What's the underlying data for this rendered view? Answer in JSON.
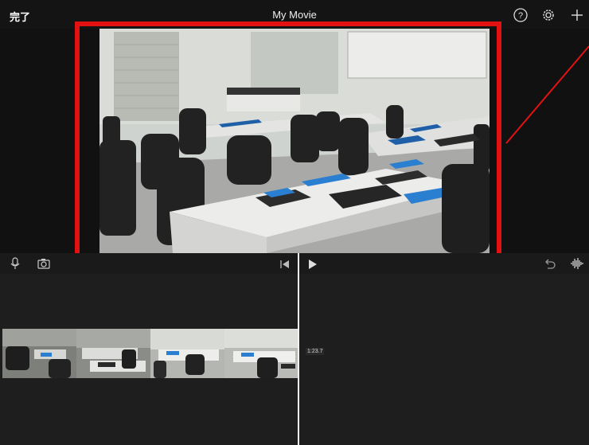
{
  "topbar": {
    "done_label": "完了",
    "title": "My Movie",
    "help_icon": "help-circle-icon",
    "settings_icon": "gear-icon",
    "add_icon": "plus-icon"
  },
  "controls": {
    "mic_icon": "microphone-icon",
    "camera_icon": "camera-icon",
    "rewind_icon": "skip-back-icon",
    "play_icon": "play-icon",
    "undo_icon": "undo-icon",
    "audio_icon": "audio-waveform-icon"
  },
  "timeline": {
    "clip_duration": "1:23.7"
  },
  "colors": {
    "highlight": "#e31212",
    "background": "#1e1e1e"
  }
}
